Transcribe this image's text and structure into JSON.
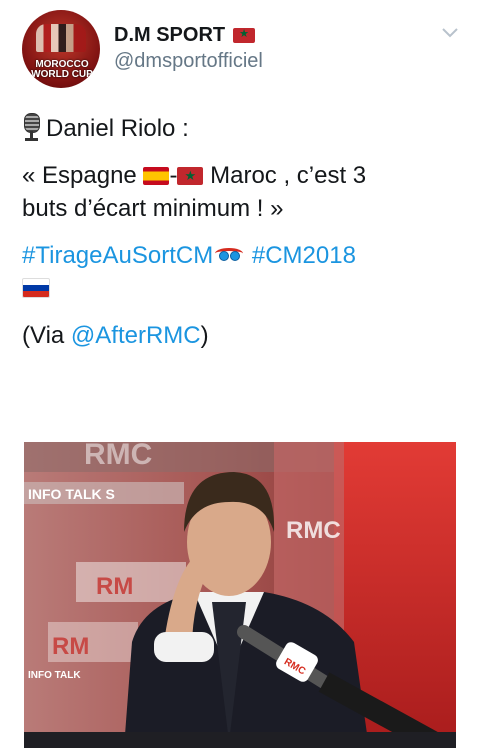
{
  "account": {
    "display_name": "D.M SPORT",
    "handle": "@dmsportofficiel",
    "avatar_text": "MOROCCO WORLD CUP",
    "name_flag": "morocco-flag-icon"
  },
  "tweet": {
    "intro": "Daniel Riolo :",
    "quote_open": "« Espagne",
    "quote_dash": "-",
    "quote_mid": "Maroc , c’est 3",
    "quote_end": "buts d’écart minimum ! »",
    "hashtag_1": "#TirageAuSortCM",
    "hashtag_2": "#CM2018",
    "via_prefix": "(Via ",
    "via_link": "@AfterRMC",
    "via_suffix": ")"
  },
  "photo": {
    "studio_sign_1": "RMC",
    "studio_sign_2": "INFO TALK S",
    "studio_sign_3": "RMC",
    "studio_sign_4": "RM",
    "studio_sign_5": "RM",
    "studio_sign_6": "INFO TALK",
    "mic_label": "RMC"
  },
  "colors": {
    "link": "#1b95e0",
    "text": "#14171a",
    "handle": "#657786"
  }
}
